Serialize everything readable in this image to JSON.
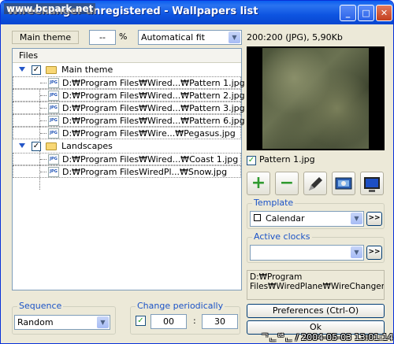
{
  "window": {
    "title": "WireChanger unregistered - Wallpapers list",
    "watermark": "www.bcpark.net",
    "controls": {
      "minimize": "_",
      "maximize": "□",
      "close": "✕"
    }
  },
  "toolbar": {
    "theme_label": "Main theme",
    "percent_value": "--",
    "percent_sign": "%",
    "fit_mode": "Automatical fit"
  },
  "image_info": "200:200 (JPG), 5,90Kb",
  "tree": {
    "header": "Files",
    "groups": [
      {
        "name": "Main theme",
        "checked": true,
        "files": [
          "D:₩Program Files₩Wired...₩Pattern 1.jpg",
          "D:₩Program Files₩Wired...₩Pattern 2.jpg",
          "D:₩Program Files₩Wired...₩Pattern 3.jpg",
          "D:₩Program Files₩Wired...₩Pattern 6.jpg",
          "D:₩Program Files₩Wire...₩Pegasus.jpg"
        ]
      },
      {
        "name": "Landscapes",
        "checked": true,
        "files": [
          "D:₩Program Files₩Wired...₩Coast 1.jpg",
          "D:₩Program FilesWiredPl...₩Snow.jpg"
        ]
      }
    ],
    "file_icon_text": "JPG"
  },
  "preview": {
    "caption": "Pattern 1.jpg",
    "checked": true
  },
  "tools": {
    "add": "+",
    "remove": "−",
    "edit_icon": "pen-icon",
    "desktop_icon": "desktop-icon",
    "monitor_icon": "monitor-icon"
  },
  "template": {
    "label": "Template",
    "value": "Calendar",
    "more": ">>"
  },
  "active_clocks": {
    "label": "Active clocks",
    "value": "",
    "more": ">>"
  },
  "path_text": "D:₩Program Files₩WiredPlane₩WireChanger₩Wallpapers₩Landscapes₩",
  "preferences_button": "Preferences (Ctrl-O)",
  "ok_button": "Ok",
  "sequence": {
    "label": "Sequence",
    "value": "Random"
  },
  "change_periodically": {
    "label": "Change periodically",
    "checked": true,
    "hours": "00",
    "separator": ":",
    "minutes": "30"
  },
  "overlay_date": "ᄀᆫᄋᄒᆫ / 2004-05-03 13:01:14",
  "colors": {
    "titlebar": "#0a5ef1",
    "window_bg": "#ece9d8",
    "group_label": "#1b53c7",
    "add_green": "#2f9a2f"
  }
}
